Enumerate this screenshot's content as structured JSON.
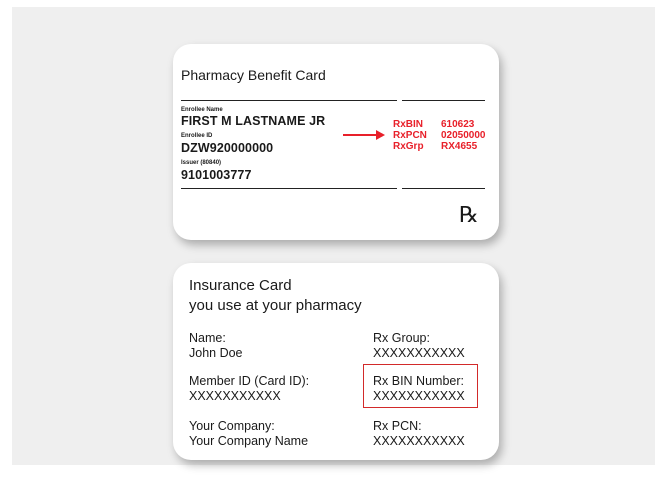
{
  "pharmacy_card": {
    "title": "Pharmacy Benefit Card",
    "enrollee_name_label": "Enrollee Name",
    "enrollee_name": "FIRST M LASTNAME JR",
    "enrollee_id_label": "Enrollee ID",
    "enrollee_id": "DZW920000000",
    "issuer_label": "Issuer (80840)",
    "issuer_id": "9101003777",
    "rxbin_label": "RxBIN",
    "rxbin_value": "610623",
    "rxpcn_label": "RxPCN",
    "rxpcn_value": "02050000",
    "rxgrp_label": "RxGrp",
    "rxgrp_value": "RX4655",
    "rx_symbol": "℞",
    "accent_color": "#e8202a"
  },
  "insurance_card": {
    "title_line1": "Insurance Card",
    "title_line2": "you use at your pharmacy",
    "name_label": "Name:",
    "name_value": "John Doe",
    "member_id_label": "Member ID (Card ID):",
    "member_id_value": "XXXXXXXXXXX",
    "company_label": "Your Company:",
    "company_value": "Your Company Name",
    "rx_group_label": "Rx Group:",
    "rx_group_value": "XXXXXXXXXXX",
    "rx_bin_label": "Rx BIN Number:",
    "rx_bin_value": "XXXXXXXXXXX",
    "rx_pcn_label": "Rx PCN:",
    "rx_pcn_value": "XXXXXXXXXXX",
    "highlight_color": "#d22a2a"
  }
}
